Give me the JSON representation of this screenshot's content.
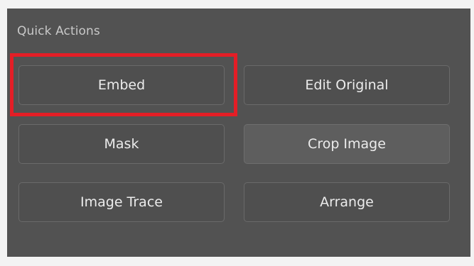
{
  "panel": {
    "title": "Quick Actions"
  },
  "buttons": {
    "embed": "Embed",
    "edit_original": "Edit Original",
    "mask": "Mask",
    "crop_image": "Crop Image",
    "image_trace": "Image Trace",
    "arrange": "Arrange"
  },
  "colors": {
    "panel_background": "#525252",
    "button_background": "#4f4f4f",
    "button_border": "#6a6a6a",
    "highlight": "#e41e26"
  }
}
